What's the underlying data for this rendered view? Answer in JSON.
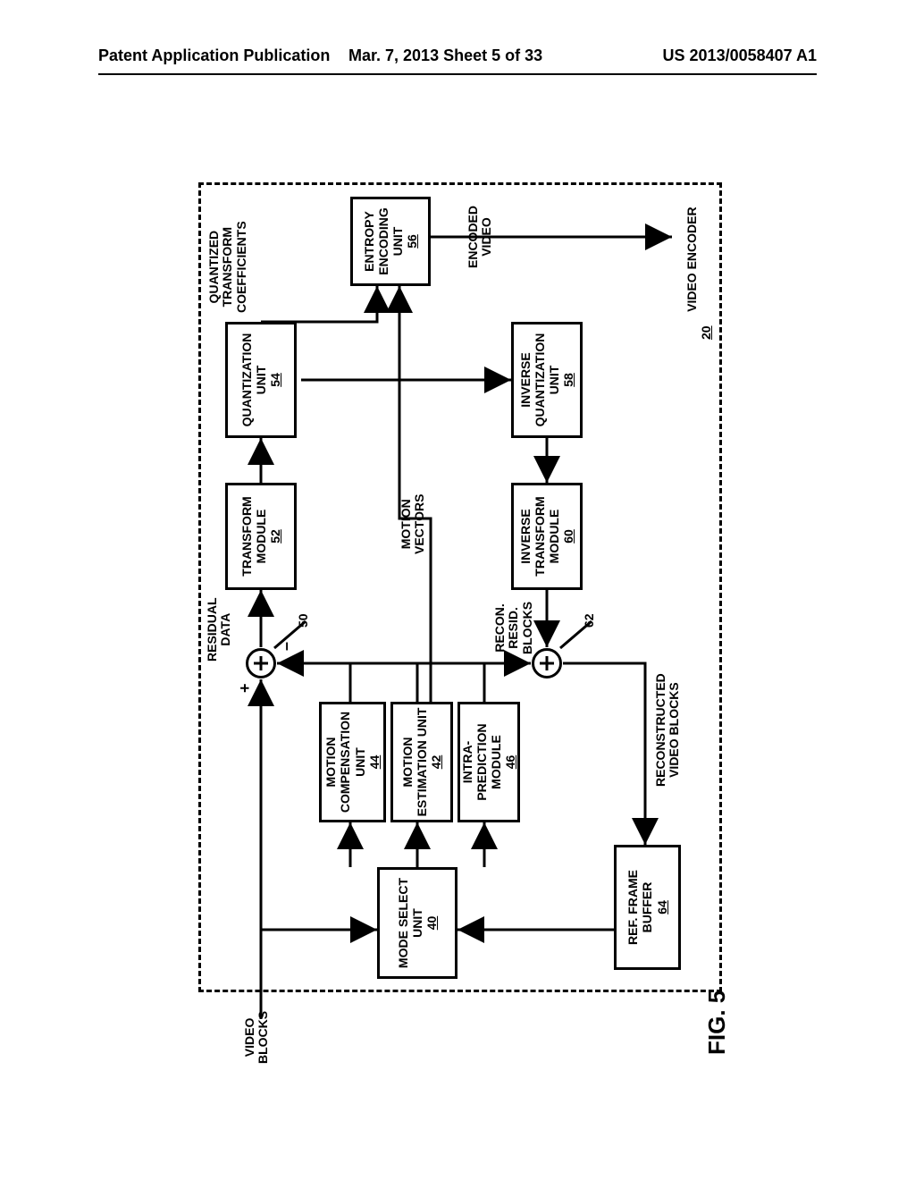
{
  "header": {
    "left": "Patent Application Publication",
    "center": "Mar. 7, 2013  Sheet 5 of 33",
    "right": "US 2013/0058407 A1"
  },
  "figure_label": "FIG. 5",
  "encoder": {
    "name": "VIDEO ENCODER",
    "num": "20"
  },
  "blocks": {
    "mode_select": {
      "name": "MODE\nSELECT\nUNIT",
      "num": "40"
    },
    "motion_est": {
      "name": "MOTION\nESTIMATION\nUNIT",
      "num": "42"
    },
    "motion_comp": {
      "name": "MOTION\nCOMPENSATION\nUNIT",
      "num": "44"
    },
    "intra_pred": {
      "name": "INTRA-\nPREDICTION\nMODULE",
      "num": "46"
    },
    "transform": {
      "name": "TRANSFORM\nMODULE",
      "num": "52"
    },
    "quant": {
      "name": "QUANTIZATION\nUNIT",
      "num": "54"
    },
    "entropy": {
      "name": "ENTROPY\nENCODING\nUNIT",
      "num": "56"
    },
    "inv_quant": {
      "name": "INVERSE\nQUANTIZATION\nUNIT",
      "num": "58"
    },
    "inv_transform": {
      "name": "INVERSE\nTRANSFORM\nMODULE",
      "num": "60"
    },
    "ref_buffer": {
      "name": "REF.\nFRAME\nBUFFER",
      "num": "64"
    }
  },
  "summers": {
    "s50": "50",
    "s62": "62"
  },
  "labels": {
    "video_blocks_in": "VIDEO\nBLOCKS",
    "residual_data": "RESIDUAL\nDATA",
    "quant_coeffs": "QUANTIZED\nTRANSFORM\nCOEFFICIENTS",
    "motion_vectors": "MOTION\nVECTORS",
    "recon_resid": "RECON.\nRESID.\nBLOCKS",
    "recon_video": "RECONSTRUCTED\nVIDEO BLOCKS",
    "encoded_video": "ENCODED\nVIDEO"
  },
  "signs": {
    "plus": "+",
    "minus": "–"
  }
}
